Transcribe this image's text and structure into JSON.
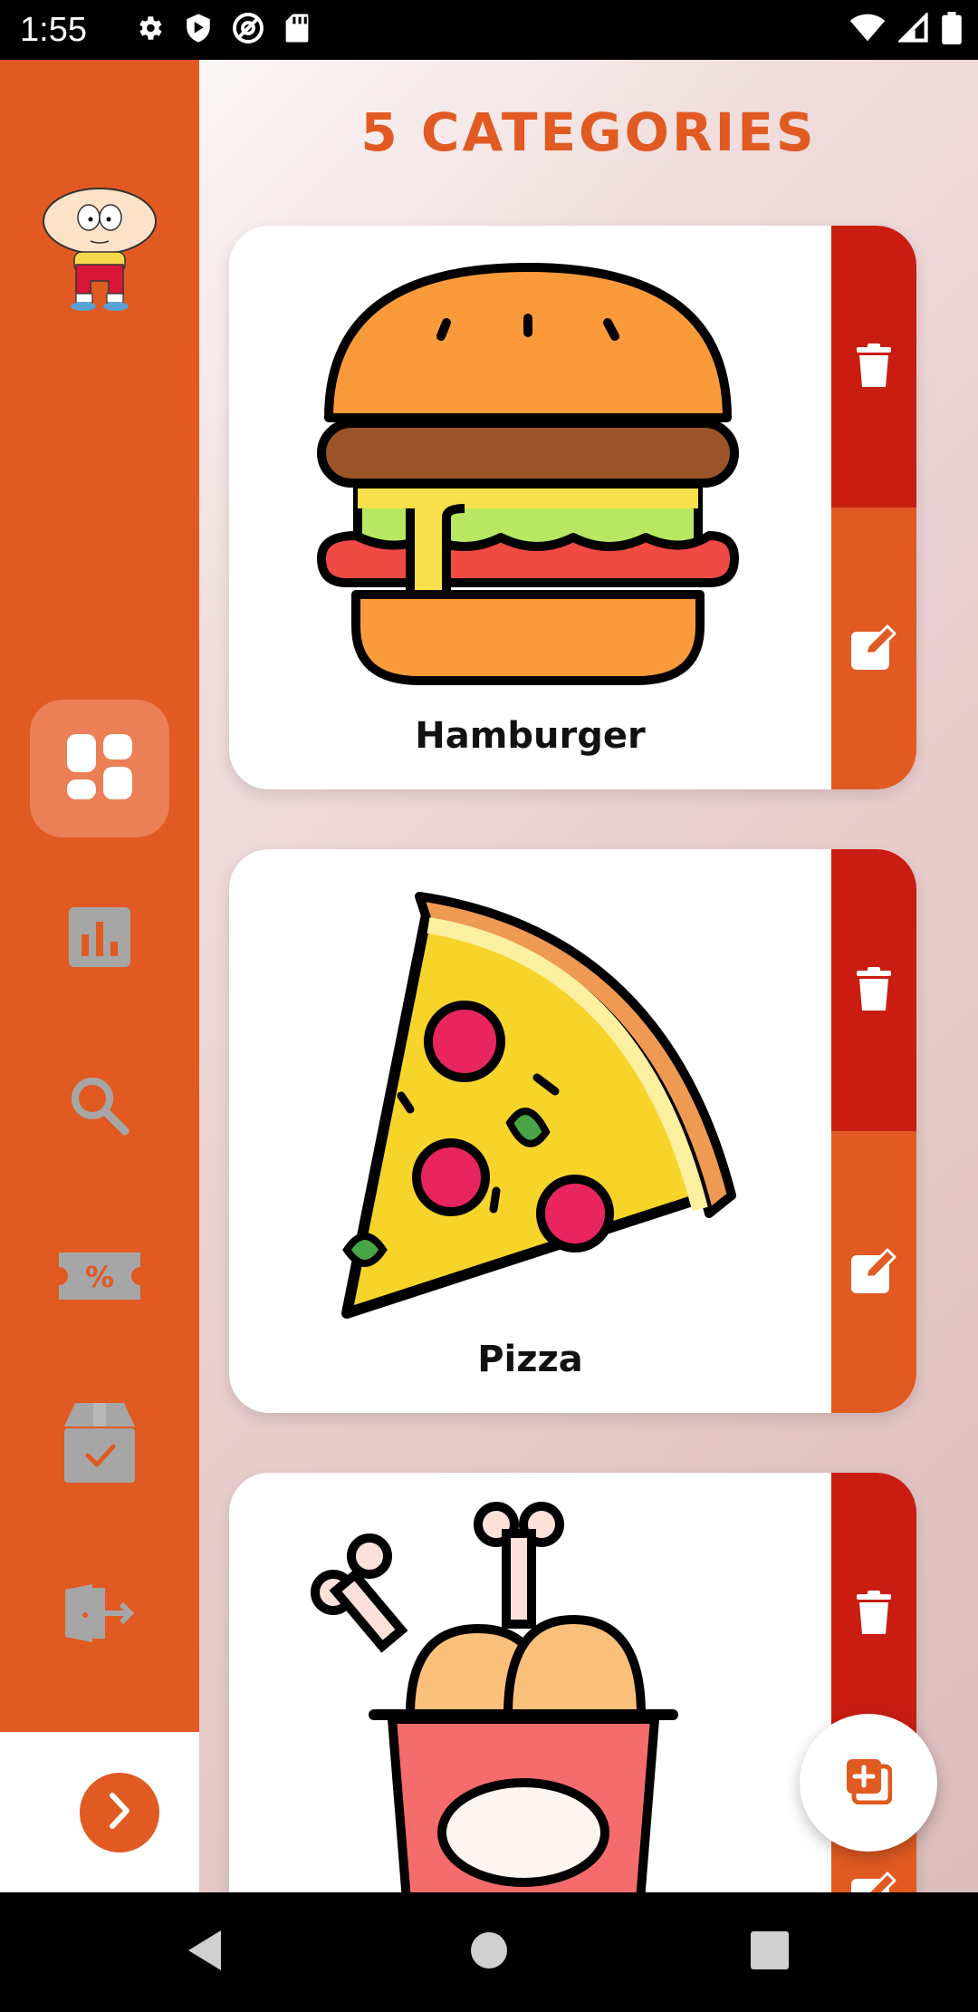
{
  "status_bar": {
    "time": "1:55",
    "left_icons": [
      "settings-icon",
      "play-protect-icon",
      "at-sign-icon",
      "sd-card-icon"
    ],
    "right_icons": [
      "wifi-icon",
      "cellular-signal-icon",
      "battery-icon"
    ]
  },
  "header": {
    "title": "5 categories"
  },
  "sidebar": {
    "avatar": "avatar",
    "items": [
      {
        "icon": "dashboard-icon",
        "active": true
      },
      {
        "icon": "bar-chart-icon",
        "active": false
      },
      {
        "icon": "search-icon",
        "active": false
      },
      {
        "icon": "coupon-icon",
        "active": false
      },
      {
        "icon": "box-check-icon",
        "active": false
      },
      {
        "icon": "logout-icon",
        "active": false
      }
    ],
    "expand_icon": "chevron-right-icon"
  },
  "categories": [
    {
      "name": "Hamburger",
      "image": "hamburger-image"
    },
    {
      "name": "Pizza",
      "image": "pizza-image"
    },
    {
      "name": "",
      "image": "fried-chicken-image"
    }
  ],
  "fab": {
    "icon": "add-category-icon"
  },
  "colors": {
    "primary": "#e05a22",
    "delete": "#c91d12",
    "active_nav": "#eb7f55"
  },
  "nav_bar": {
    "buttons": [
      "back-icon",
      "home-icon",
      "recents-icon"
    ]
  }
}
